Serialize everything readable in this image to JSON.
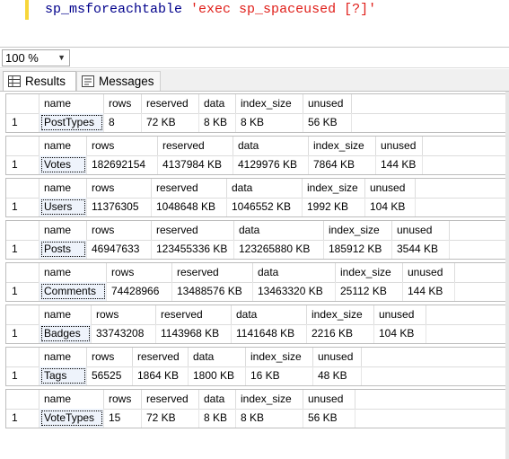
{
  "editor": {
    "line": {
      "func": "sp_msforeachtable",
      "arg": "'exec sp_spaceused [?]'"
    }
  },
  "toolbar": {
    "zoom": "100 %"
  },
  "tabs": {
    "results": "Results",
    "messages": "Messages"
  },
  "result_sets": [
    {
      "columns": [
        "name",
        "rows",
        "reserved",
        "data",
        "index_size",
        "unused"
      ],
      "row_num": "1",
      "values": [
        "PostTypes",
        "8",
        "72 KB",
        "8 KB",
        "8 KB",
        "56 KB"
      ]
    },
    {
      "columns": [
        "name",
        "rows",
        "reserved",
        "data",
        "index_size",
        "unused"
      ],
      "row_num": "1",
      "values": [
        "Votes",
        "182692154",
        "4137984 KB",
        "4129976 KB",
        "7864 KB",
        "144 KB"
      ]
    },
    {
      "columns": [
        "name",
        "rows",
        "reserved",
        "data",
        "index_size",
        "unused"
      ],
      "row_num": "1",
      "values": [
        "Users",
        "11376305",
        "1048648 KB",
        "1046552 KB",
        "1992 KB",
        "104 KB"
      ]
    },
    {
      "columns": [
        "name",
        "rows",
        "reserved",
        "data",
        "index_size",
        "unused"
      ],
      "row_num": "1",
      "values": [
        "Posts",
        "46947633",
        "123455336 KB",
        "123265880 KB",
        "185912 KB",
        "3544 KB"
      ]
    },
    {
      "columns": [
        "name",
        "rows",
        "reserved",
        "data",
        "index_size",
        "unused"
      ],
      "row_num": "1",
      "values": [
        "Comments",
        "74428966",
        "13488576 KB",
        "13463320 KB",
        "25112 KB",
        "144 KB"
      ]
    },
    {
      "columns": [
        "name",
        "rows",
        "reserved",
        "data",
        "index_size",
        "unused"
      ],
      "row_num": "1",
      "values": [
        "Badges",
        "33743208",
        "1143968 KB",
        "1141648 KB",
        "2216 KB",
        "104 KB"
      ]
    },
    {
      "columns": [
        "name",
        "rows",
        "reserved",
        "data",
        "index_size",
        "unused"
      ],
      "row_num": "1",
      "values": [
        "Tags",
        "56525",
        "1864 KB",
        "1800 KB",
        "16 KB",
        "48 KB"
      ]
    },
    {
      "columns": [
        "name",
        "rows",
        "reserved",
        "data",
        "index_size",
        "unused"
      ],
      "row_num": "1",
      "values": [
        "VoteTypes",
        "15",
        "72 KB",
        "8 KB",
        "8 KB",
        "56 KB"
      ]
    }
  ]
}
